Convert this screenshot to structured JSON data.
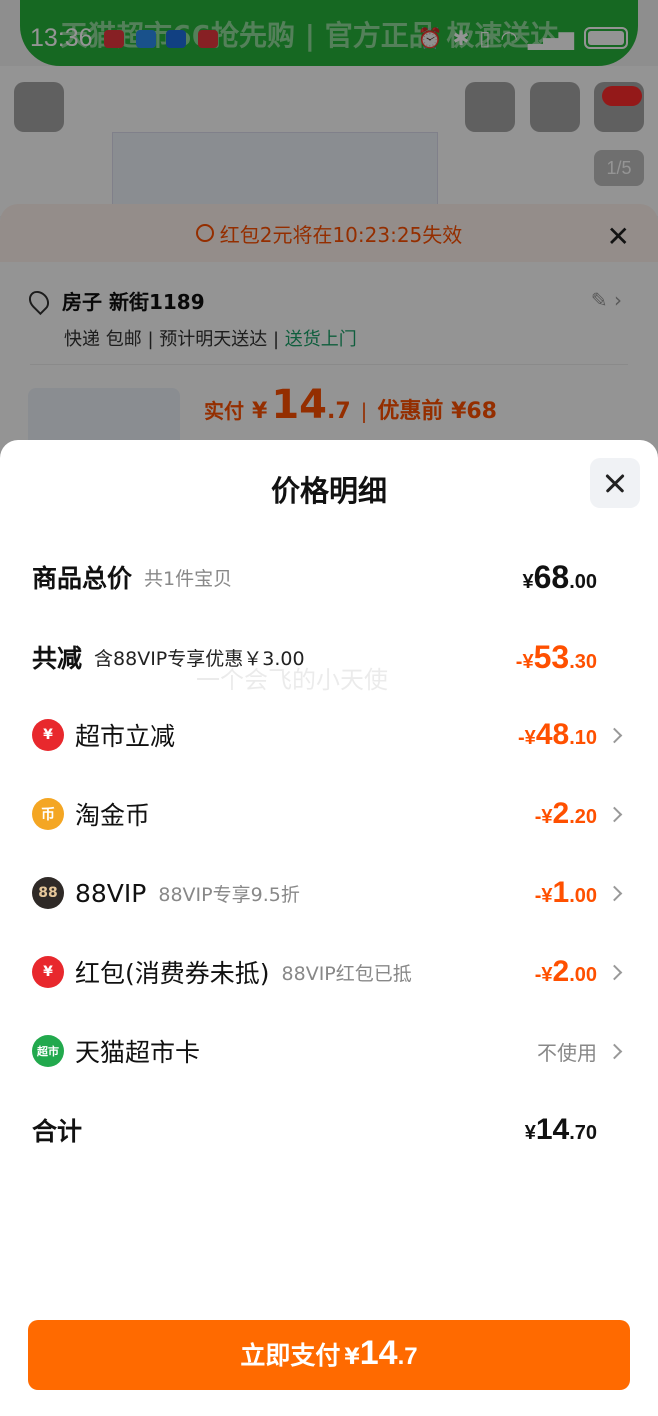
{
  "status_bar": {
    "time": "13:36"
  },
  "banner": {
    "text": "天猫超市66抢先购 | 官方正品 极速送达"
  },
  "product": {
    "pager": "1/5"
  },
  "order": {
    "timer_text": "红包2元将在10:23:25失效",
    "address": "房子 新街1189",
    "delivery_left": "快递 包邮 | 预计明天送达 | ",
    "delivery_green": "送货上门",
    "pay_label": "实付",
    "pay_yen": "¥",
    "pay_int": "14",
    "pay_dec": ".7",
    "before_label": "优惠前 ¥68"
  },
  "modal": {
    "title": "价格明细",
    "watermark": "一个会飞的小天使",
    "rows": [
      {
        "label": "商品总价",
        "sub": "共1件宝贝",
        "yen": "¥",
        "int": "68",
        "dec": ".00",
        "color": "#111111"
      },
      {
        "label": "共减",
        "sub": "含88VIP专享优惠￥3.00",
        "yen": "-¥",
        "int": "53",
        "dec": ".30",
        "color": "#ff5000"
      },
      {
        "label": "超市立减",
        "icon": "supermarket-discount-icon",
        "icon_text": "¥",
        "yen": "-¥",
        "int": "48",
        "dec": ".10"
      },
      {
        "label": "淘金币",
        "icon": "taojinbi-coin-icon",
        "icon_text": "币",
        "yen": "-¥",
        "int": "2",
        "dec": ".20"
      },
      {
        "label": "88VIP",
        "sub": "88VIP专享9.5折",
        "icon": "88vip-icon",
        "icon_text": "88",
        "yen": "-¥",
        "int": "1",
        "dec": ".00"
      },
      {
        "label": "红包(消费券未抵)",
        "sub": "88VIP红包已抵",
        "icon": "red-envelope-icon",
        "icon_text": "¥",
        "yen": "-¥",
        "int": "2",
        "dec": ".00"
      },
      {
        "label": "天猫超市卡",
        "icon": "tmall-supermarket-card-icon",
        "icon_text": "超市",
        "right_text": "不使用"
      },
      {
        "label": "合计",
        "yen": "¥",
        "int": "14",
        "dec": ".70"
      }
    ],
    "pay_button": {
      "label": "立即支付",
      "yen": "¥",
      "int": "14",
      "dec": ".7",
      "color": "#ff6a00"
    }
  }
}
